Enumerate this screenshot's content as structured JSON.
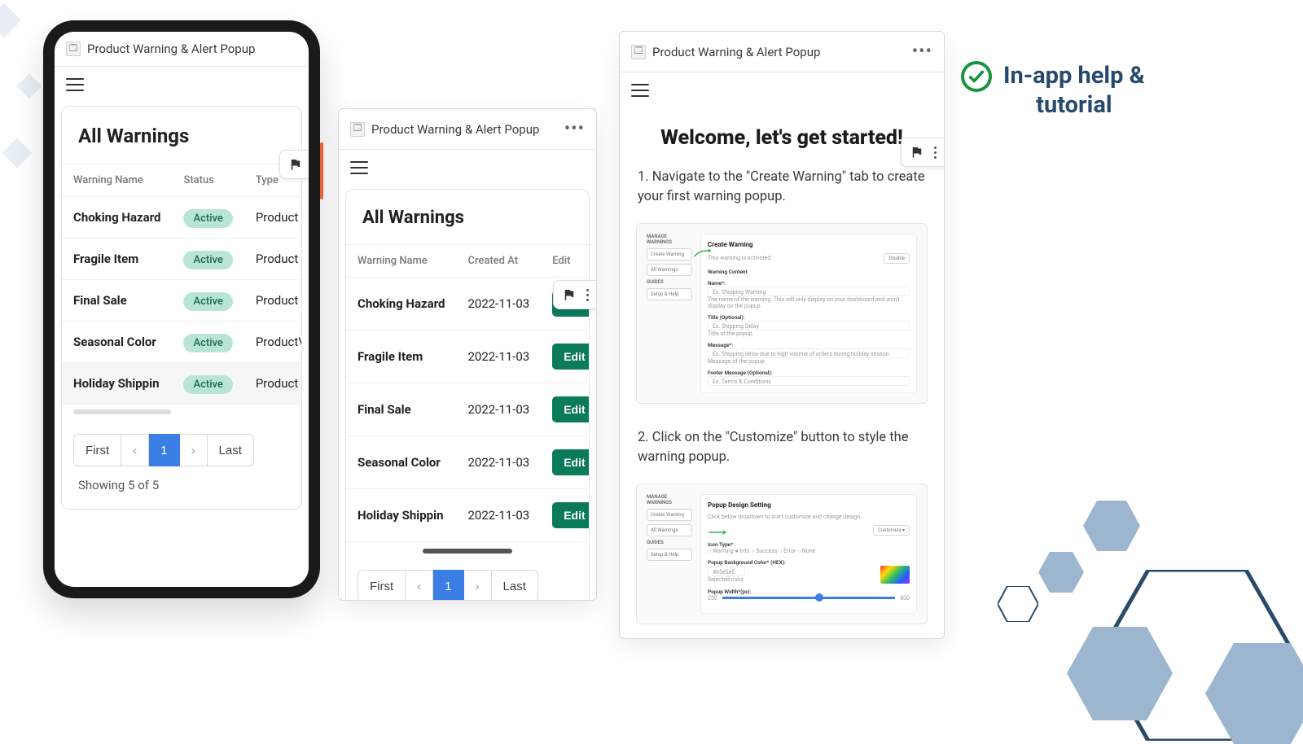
{
  "app_title": "Product Warning & Alert Popup",
  "heading_all_warnings": "All Warnings",
  "cols_phone": {
    "name": "Warning Name",
    "status": "Status",
    "type": "Type"
  },
  "cols_mid": {
    "name": "Warning Name",
    "created": "Created At",
    "edit": "Edit"
  },
  "edit_label": "Edit",
  "status_active": "Active",
  "rows": [
    {
      "name": "Choking Hazard",
      "type": "Product",
      "created": "2022-11-03"
    },
    {
      "name": "Fragile Item",
      "type": "Product",
      "created": "2022-11-03"
    },
    {
      "name": "Final Sale",
      "type": "Product",
      "created": "2022-11-03"
    },
    {
      "name": "Seasonal Color",
      "type": "ProductVa",
      "created": "2022-11-03"
    },
    {
      "name": "Holiday Shippin",
      "type": "Product",
      "created": "2022-11-03"
    }
  ],
  "pager": {
    "first": "First",
    "last": "Last",
    "page": "1"
  },
  "showing": "Showing 5 of 5",
  "tutorial": {
    "welcome": "Welcome, let's get started!",
    "step1": "1. Navigate to the \"Create Warning\" tab to create your first warning popup.",
    "step2": "2. Click on the \"Customize\" button to style the warning popup.",
    "sidebar": {
      "hdr1": "MANAGE WARNINGS",
      "create": "Create Warning",
      "all": "All Warnings",
      "hdr2": "GUIDES",
      "help": "Setup & Help"
    },
    "mock1": {
      "title": "Create Warning",
      "activated": "This warning is activated",
      "disable": "Disable",
      "content_hdr": "Warning Content",
      "name_lbl": "Name*:",
      "name_ph": "Ex. Shipping Warning",
      "name_desc": "The name of the warning. This will only display on your dashboard and won't display on the popup.",
      "title_lbl": "Title (Optional):",
      "title_ph": "Ex. Shipping Delay",
      "title_desc": "Title of the popup.",
      "msg_lbl": "Message*:",
      "msg_ph": "Ex. Shipping delay due to high volume of orders during holiday season",
      "msg_desc": "Message of the popup.",
      "footer_lbl": "Footer Message (Optional):",
      "footer_ph": "Ex. Terms & Conditions"
    },
    "mock2": {
      "title": "Popup Design Setting",
      "desc": "Click below dropdown to start customize and change design.",
      "customize": "Customize ▾",
      "icon_lbl": "Icon Type*:",
      "radios": "○ Warning   ● Info   ○ Success   ○ Error   ○ None",
      "color_lbl": "Popup Background Color* (HEX):",
      "hex": "#e5e5e5",
      "selected": "Selected color",
      "width_lbl": "Popup Width*(px):",
      "width_lo": "250",
      "width_hi": "800"
    }
  },
  "callout": {
    "line1": "In-app help &",
    "line2": "tutorial"
  }
}
